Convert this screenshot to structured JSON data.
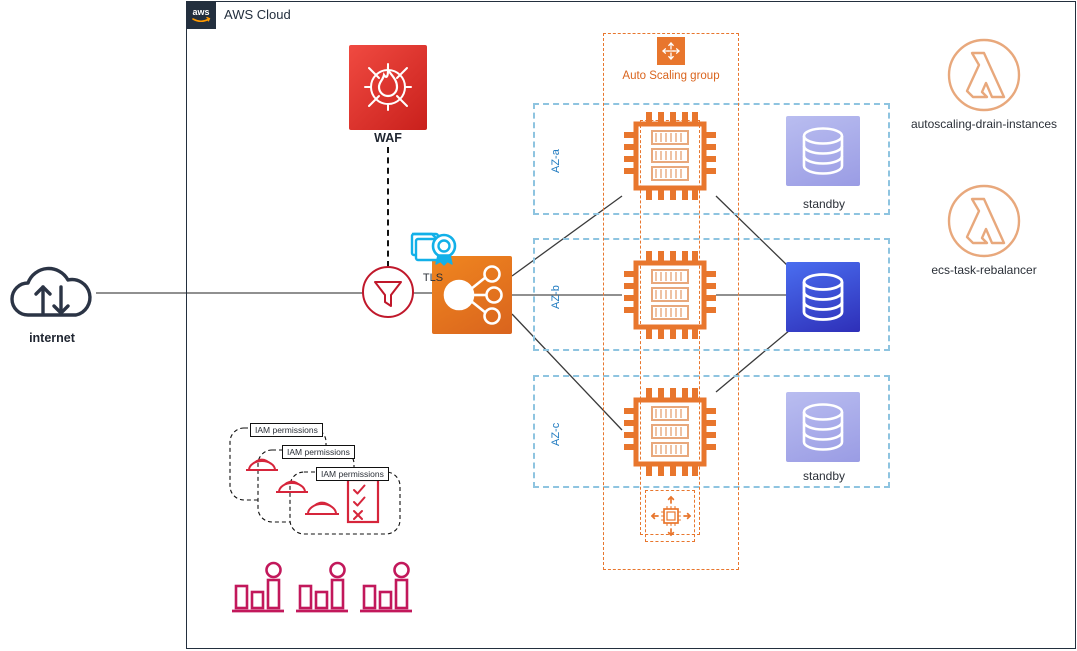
{
  "cloud": {
    "title": "AWS Cloud",
    "logo": "aws-logo"
  },
  "internet": {
    "label": "internet",
    "icon": "cloud-updown-arrows-icon"
  },
  "waf": {
    "label": "WAF",
    "icon": "waf-firewall-icon"
  },
  "filter": {
    "icon": "filter-funnel-icon"
  },
  "tls": {
    "label": "TLS",
    "icon": "certificate-icon"
  },
  "load_balancer": {
    "icon": "elastic-load-balancer-icon"
  },
  "auto_scaling_group": {
    "label": "Auto Scaling group",
    "icon": "auto-scaling-icon"
  },
  "scaling_action": {
    "icon": "ec2-instance-scaling-icon"
  },
  "availability_zones": [
    {
      "label": "AZ-a",
      "instance_icon": "ec2-instance-icon",
      "db_label": "standby",
      "db_role": "standby"
    },
    {
      "label": "AZ-b",
      "instance_icon": "ec2-instance-icon",
      "db_label": "",
      "db_role": "primary"
    },
    {
      "label": "AZ-c",
      "instance_icon": "ec2-instance-icon",
      "db_label": "standby",
      "db_role": "standby"
    }
  ],
  "lambdas": [
    {
      "label": "autoscaling-drain-instances",
      "icon": "lambda-icon"
    },
    {
      "label": "ecs-task-rebalancer",
      "icon": "lambda-icon"
    }
  ],
  "iam": {
    "tags": [
      "IAM permissions",
      "IAM permissions",
      "IAM permissions"
    ],
    "icon": "iam-hardhat-icon",
    "checklist_icon": "permissions-checklist-icon"
  },
  "metrics": [
    {
      "icon": "cloudwatch-metric-icon"
    },
    {
      "icon": "cloudwatch-metric-icon"
    },
    {
      "icon": "cloudwatch-metric-icon"
    }
  ],
  "colors": {
    "aws_navy": "#232F3E",
    "orange": "#E8762D",
    "waf_red": "#C9201C",
    "db_primary_blue": "#2e2fb8",
    "db_standby_purple": "#9a9ce4",
    "az_blue": "#1f7ac0",
    "lambda_salmon": "#E8A87C",
    "iam_red": "#D6253B",
    "metric_magenta": "#C2185B",
    "tls_cyan": "#12B0E8"
  }
}
